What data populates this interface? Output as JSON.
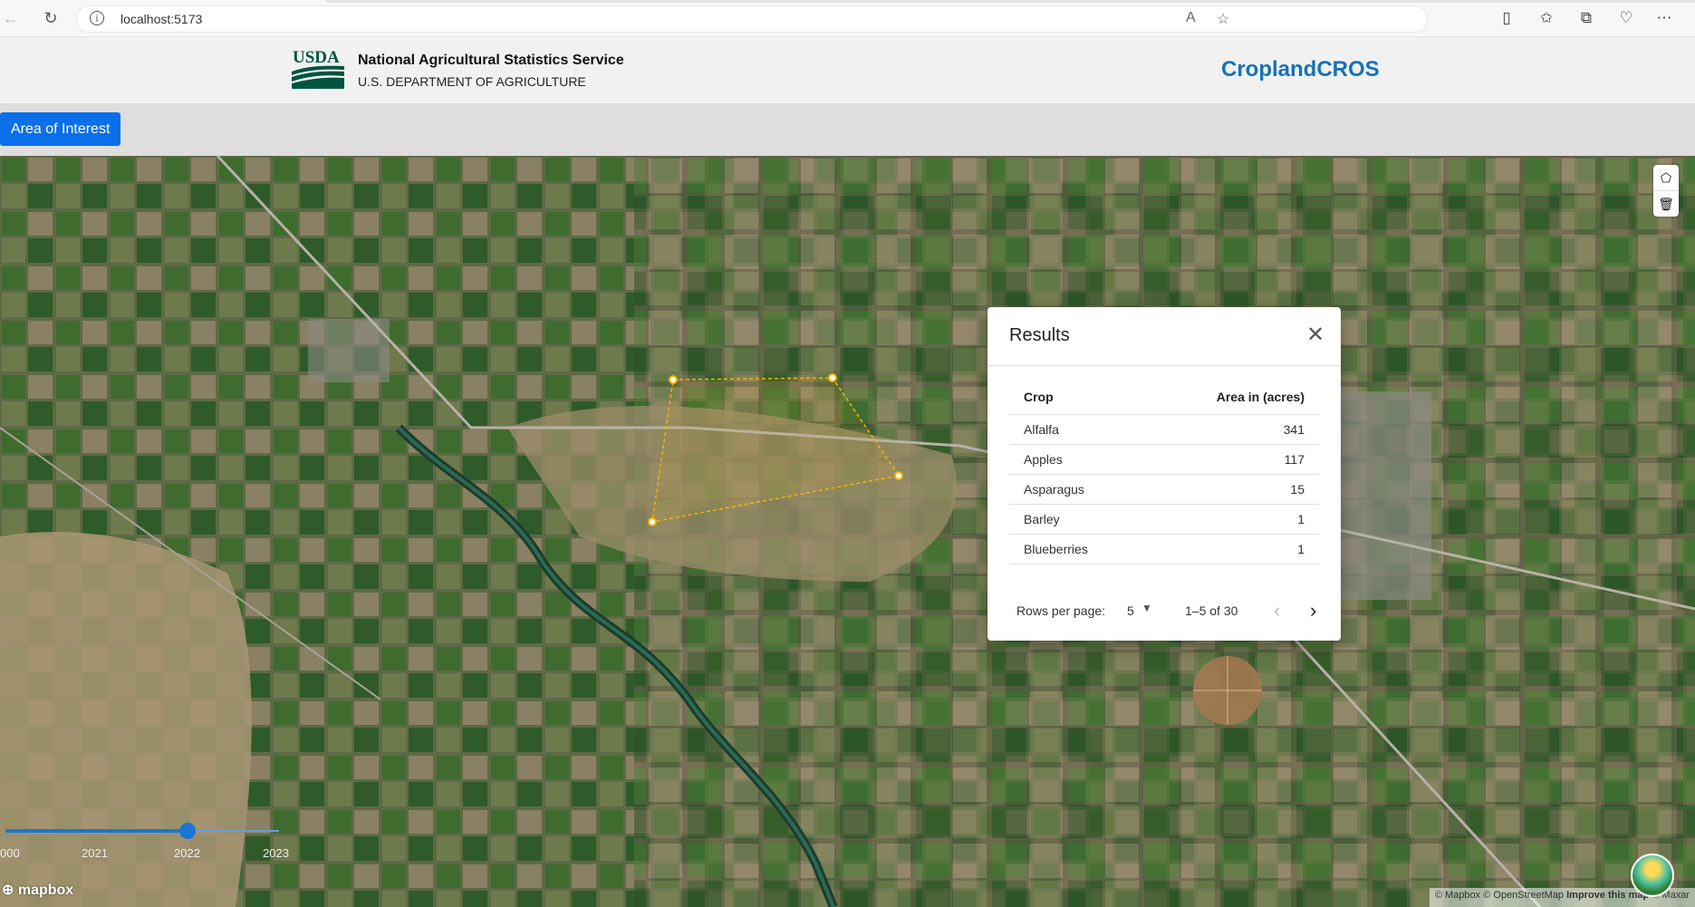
{
  "browser": {
    "url": "localhost:5173"
  },
  "header": {
    "logo_text": "USDA",
    "agency_name": "National Agricultural Statistics Service",
    "department": "U.S. DEPARTMENT OF AGRICULTURE",
    "app_title": "CroplandCROS"
  },
  "toolbar": {
    "aoi_label": "Area of Interest"
  },
  "results": {
    "title": "Results",
    "columns": [
      "Crop",
      "Area in (acres)"
    ],
    "rows": [
      {
        "crop": "Alfalfa",
        "area": "341"
      },
      {
        "crop": "Apples",
        "area": "117"
      },
      {
        "crop": "Asparagus",
        "area": "15"
      },
      {
        "crop": "Barley",
        "area": "1"
      },
      {
        "crop": "Blueberries",
        "area": "1"
      }
    ],
    "rows_per_page_label": "Rows per page:",
    "rows_per_page": "5",
    "range": "1–5 of 30"
  },
  "year_slider": {
    "labels": [
      "000",
      "2021",
      "2022",
      "2023"
    ],
    "selected": "2022"
  },
  "map": {
    "logo": "mapbox",
    "attribution": {
      "mapbox": "© Mapbox",
      "osm": "© OpenStreetMap",
      "improve": "Improve this map",
      "maxar": "© Maxar"
    }
  },
  "colors": {
    "brand_blue": "#1672b8",
    "button_blue": "#0a6fe8",
    "slider_blue": "#1976d2",
    "polygon_line": "#f4b400"
  }
}
